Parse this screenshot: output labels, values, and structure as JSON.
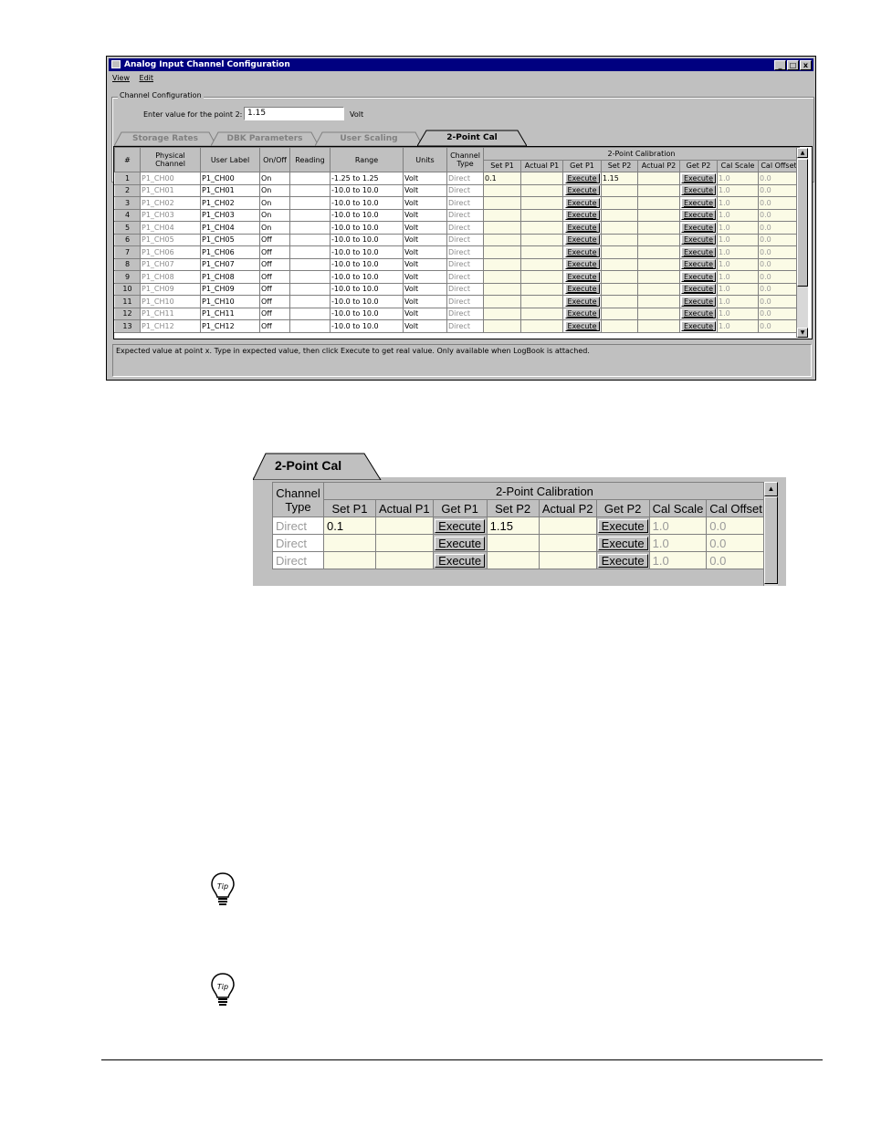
{
  "window": {
    "title": "Analog Input Channel Configuration",
    "controls": [
      "_",
      "□",
      "x"
    ],
    "menu": [
      "View",
      "Edit"
    ],
    "group_label": "Channel Configuration",
    "prompt": "Enter value for the point 2:",
    "point_value": "1.15",
    "unit": "Volt",
    "tabs": [
      "Storage Rates",
      "DBK Parameters",
      "User Scaling",
      "2-Point Cal"
    ],
    "active_tab": "2-Point Cal",
    "status": "Expected value at point x. Type in expected value, then click Execute to get real value. Only available when LogBook is attached."
  },
  "grid": {
    "group_header": "2-Point Calibration",
    "columns": [
      "#",
      "Physical Channel",
      "User Label",
      "On/Off",
      "Reading",
      "Range",
      "Units",
      "Channel Type",
      "Set P1",
      "Actual P1",
      "Get P1",
      "Set P2",
      "Actual P2",
      "Get P2",
      "Cal Scale",
      "Cal Offset"
    ],
    "execute_label": "Execute",
    "rows": [
      {
        "n": "1",
        "phys": "P1_CH00",
        "label": "P1_CH00",
        "onoff": "On",
        "reading": "",
        "range": "-1.25 to 1.25",
        "units": "Volt",
        "type": "Direct",
        "setp1": "0.1",
        "setp2": "1.15",
        "scale": "1.0",
        "offset": "0.0"
      },
      {
        "n": "2",
        "phys": "P1_CH01",
        "label": "P1_CH01",
        "onoff": "On",
        "reading": "",
        "range": "-10.0 to 10.0",
        "units": "Volt",
        "type": "Direct",
        "setp1": "",
        "setp2": "",
        "scale": "1.0",
        "offset": "0.0"
      },
      {
        "n": "3",
        "phys": "P1_CH02",
        "label": "P1_CH02",
        "onoff": "On",
        "reading": "",
        "range": "-10.0 to 10.0",
        "units": "Volt",
        "type": "Direct",
        "setp1": "",
        "setp2": "",
        "scale": "1.0",
        "offset": "0.0"
      },
      {
        "n": "4",
        "phys": "P1_CH03",
        "label": "P1_CH03",
        "onoff": "On",
        "reading": "",
        "range": "-10.0 to 10.0",
        "units": "Volt",
        "type": "Direct",
        "setp1": "",
        "setp2": "",
        "scale": "1.0",
        "offset": "0.0"
      },
      {
        "n": "5",
        "phys": "P1_CH04",
        "label": "P1_CH04",
        "onoff": "On",
        "reading": "",
        "range": "-10.0 to 10.0",
        "units": "Volt",
        "type": "Direct",
        "setp1": "",
        "setp2": "",
        "scale": "1.0",
        "offset": "0.0"
      },
      {
        "n": "6",
        "phys": "P1_CH05",
        "label": "P1_CH05",
        "onoff": "Off",
        "reading": "",
        "range": "-10.0 to 10.0",
        "units": "Volt",
        "type": "Direct",
        "setp1": "",
        "setp2": "",
        "scale": "1.0",
        "offset": "0.0"
      },
      {
        "n": "7",
        "phys": "P1_CH06",
        "label": "P1_CH06",
        "onoff": "Off",
        "reading": "",
        "range": "-10.0 to 10.0",
        "units": "Volt",
        "type": "Direct",
        "setp1": "",
        "setp2": "",
        "scale": "1.0",
        "offset": "0.0"
      },
      {
        "n": "8",
        "phys": "P1_CH07",
        "label": "P1_CH07",
        "onoff": "Off",
        "reading": "",
        "range": "-10.0 to 10.0",
        "units": "Volt",
        "type": "Direct",
        "setp1": "",
        "setp2": "",
        "scale": "1.0",
        "offset": "0.0"
      },
      {
        "n": "9",
        "phys": "P1_CH08",
        "label": "P1_CH08",
        "onoff": "Off",
        "reading": "",
        "range": "-10.0 to 10.0",
        "units": "Volt",
        "type": "Direct",
        "setp1": "",
        "setp2": "",
        "scale": "1.0",
        "offset": "0.0"
      },
      {
        "n": "10",
        "phys": "P1_CH09",
        "label": "P1_CH09",
        "onoff": "Off",
        "reading": "",
        "range": "-10.0 to 10.0",
        "units": "Volt",
        "type": "Direct",
        "setp1": "",
        "setp2": "",
        "scale": "1.0",
        "offset": "0.0"
      },
      {
        "n": "11",
        "phys": "P1_CH10",
        "label": "P1_CH10",
        "onoff": "Off",
        "reading": "",
        "range": "-10.0 to 10.0",
        "units": "Volt",
        "type": "Direct",
        "setp1": "",
        "setp2": "",
        "scale": "1.0",
        "offset": "0.0"
      },
      {
        "n": "12",
        "phys": "P1_CH11",
        "label": "P1_CH11",
        "onoff": "Off",
        "reading": "",
        "range": "-10.0 to 10.0",
        "units": "Volt",
        "type": "Direct",
        "setp1": "",
        "setp2": "",
        "scale": "1.0",
        "offset": "0.0"
      },
      {
        "n": "13",
        "phys": "P1_CH12",
        "label": "P1_CH12",
        "onoff": "Off",
        "reading": "",
        "range": "-10.0 to 10.0",
        "units": "Volt",
        "type": "Direct",
        "setp1": "",
        "setp2": "",
        "scale": "1.0",
        "offset": "0.0"
      }
    ]
  },
  "zoom": {
    "tab": "2-Point Cal",
    "group_header": "2-Point Calibration",
    "columns": [
      "Channel Type",
      "Set P1",
      "Actual P1",
      "Get P1",
      "Set P2",
      "Actual P2",
      "Get P2",
      "Cal Scale",
      "Cal Offset"
    ],
    "execute_label": "Execute",
    "rows": [
      {
        "type": "Direct",
        "setp1": "0.1",
        "setp2": "1.15",
        "scale": "1.0",
        "offset": "0.0"
      },
      {
        "type": "Direct",
        "setp1": "",
        "setp2": "",
        "scale": "1.0",
        "offset": "0.0"
      },
      {
        "type": "Direct",
        "setp1": "",
        "setp2": "",
        "scale": "1.0",
        "offset": "0.0"
      }
    ]
  },
  "icons": [
    "tip-bulb-icon",
    "tip-bulb-icon"
  ],
  "tip_text": "Tip"
}
